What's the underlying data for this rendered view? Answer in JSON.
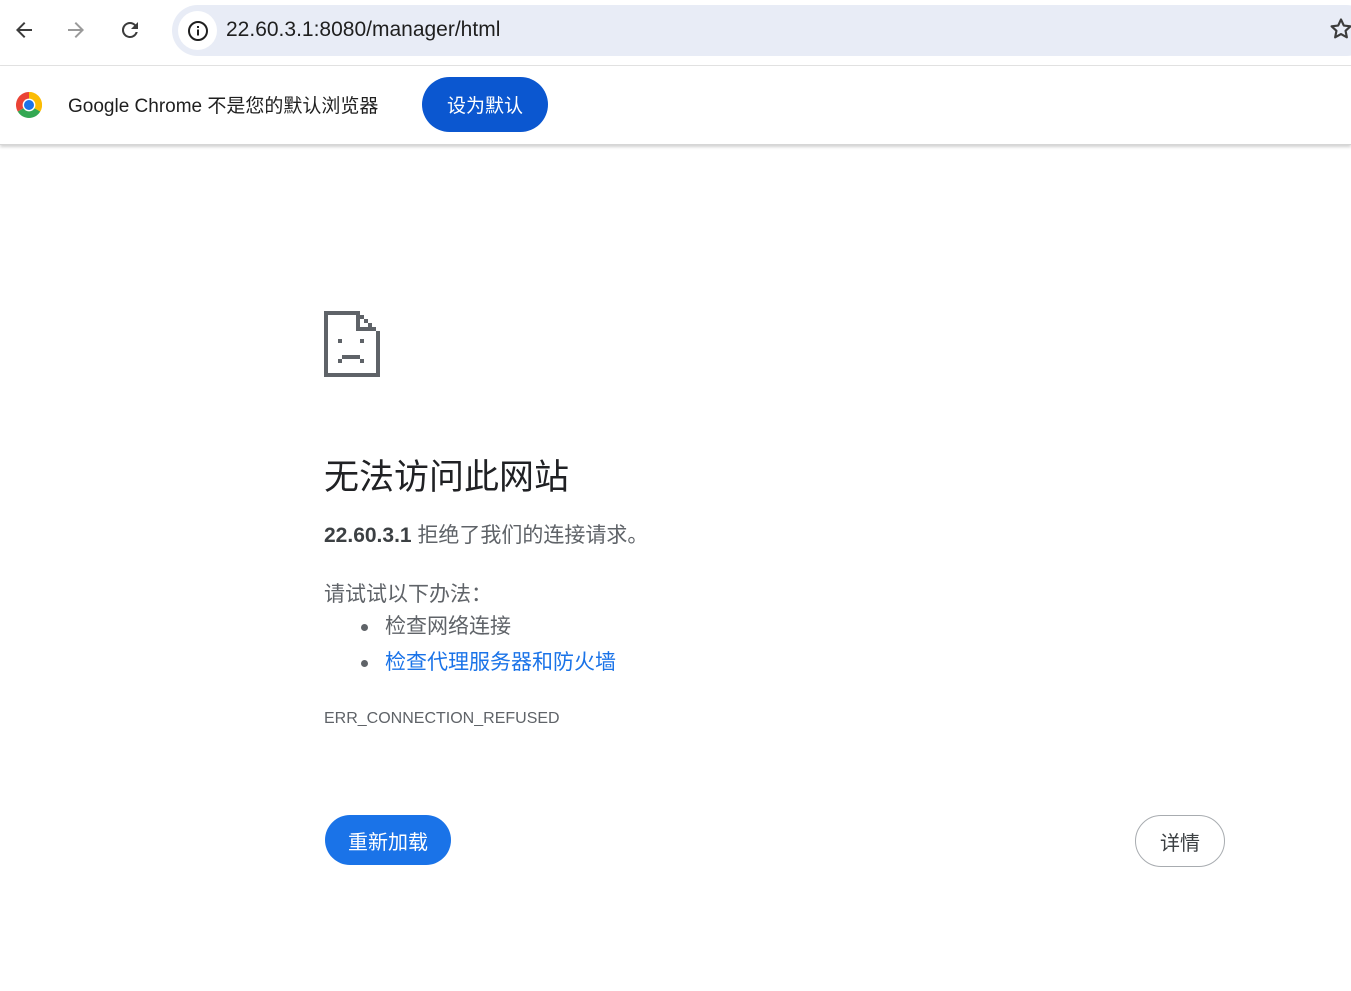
{
  "toolbar": {
    "back_icon": "arrow-left-icon",
    "forward_icon": "arrow-right-icon",
    "reload_icon": "reload-icon",
    "site_info_icon": "info-icon",
    "url": "22.60.3.1:8080/manager/html",
    "bookmark_icon": "star-icon"
  },
  "infobar": {
    "logo_icon": "chrome-logo-icon",
    "message": "Google Chrome 不是您的默认浏览器",
    "set_default_label": "设为默认"
  },
  "error": {
    "icon": "sad-document-icon",
    "title": "无法访问此网站",
    "host": "22.60.3.1",
    "description": "拒绝了我们的连接请求。",
    "try_label": "请试试以下办法：",
    "suggestions": [
      "检查网络连接",
      "检查代理服务器和防火墙"
    ],
    "code": "ERR_CONNECTION_REFUSED",
    "reload_label": "重新加载",
    "details_label": "详情"
  },
  "colors": {
    "accent": "#1a73e8",
    "infobar_button": "#0b57d0",
    "omnibox_bg": "#e8ecf6",
    "link": "#1a73e8",
    "secondary_text": "#5f6368"
  }
}
